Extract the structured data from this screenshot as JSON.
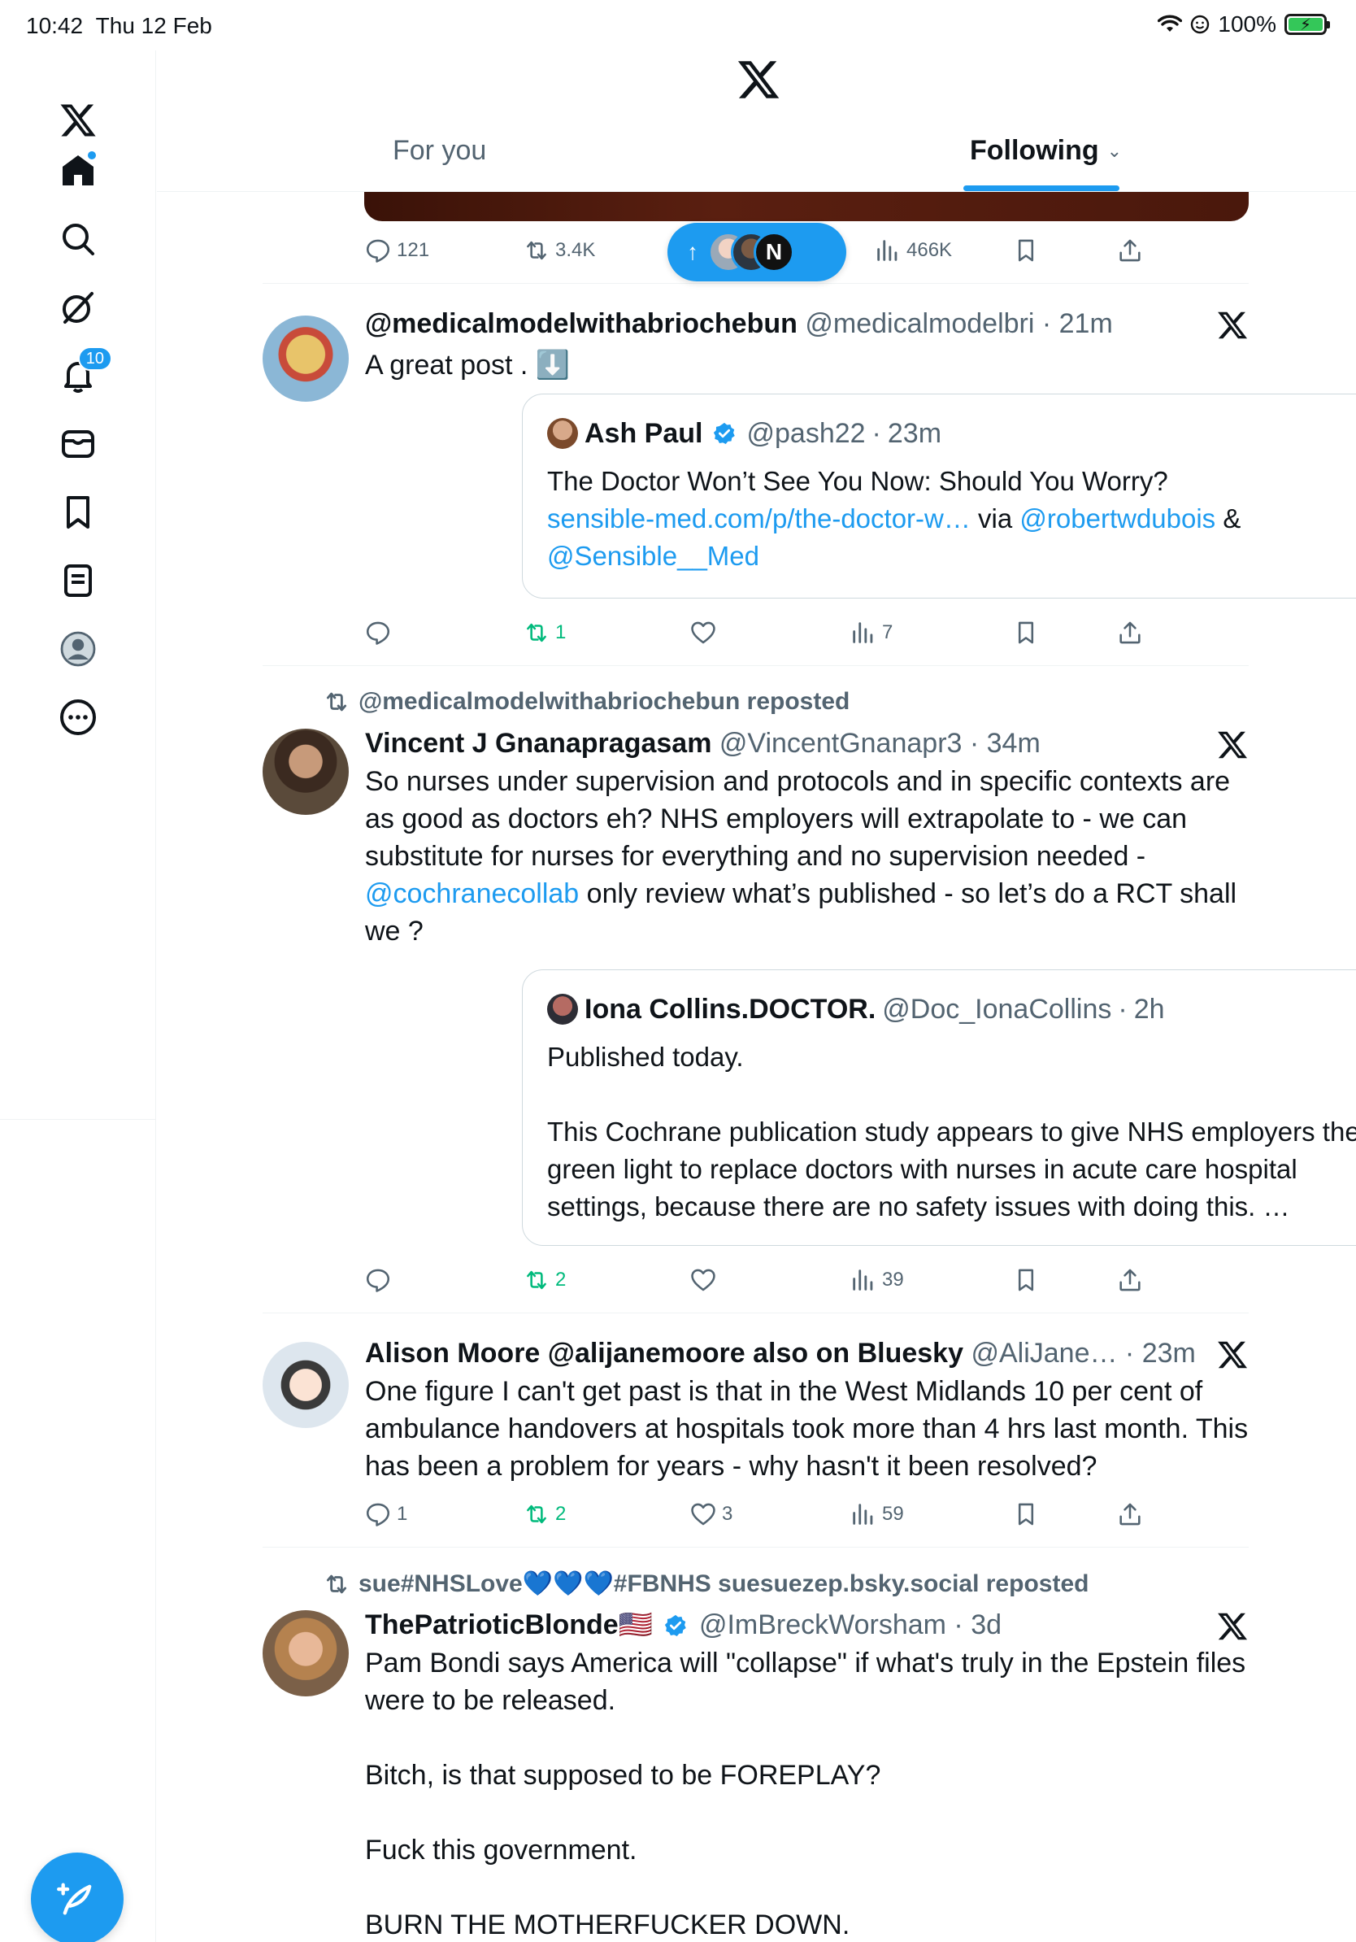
{
  "status_bar": {
    "time": "10:42",
    "date": "Thu 12 Feb",
    "battery": "100%"
  },
  "nav": {
    "notifications_count": "10"
  },
  "header": {
    "tabs": [
      {
        "label": "For you"
      },
      {
        "label": "Following"
      }
    ]
  },
  "colors": {
    "accent": "#1d9bf0",
    "repost_green": "#00ba7c",
    "muted": "#536471"
  },
  "posts": [
    {
      "actions": {
        "replies": "121",
        "reposts": "3.4K",
        "views": "466K"
      }
    },
    {
      "name": "@medicalmodelwithabriochebun",
      "handle": "@medicalmodelbri",
      "time": "21m",
      "text": "A great post .",
      "emoji": "⬇️",
      "quote": {
        "name": "Ash Paul",
        "handle": "@pash22",
        "time": "23m",
        "text": "The Doctor Won’t See You Now: Should You Worry?",
        "link": "sensible-med.com/p/the-doctor-w…",
        "via": "via",
        "mention1": "@robertwdubois",
        "amp": "&",
        "mention2": "@Sensible__Med"
      },
      "actions": {
        "reposts": "1",
        "views": "7"
      }
    },
    {
      "repost_label": "@medicalmodelwithabriochebun reposted",
      "name": "Vincent J Gnanapragasam",
      "handle": "@VincentGnanapr3",
      "time": "34m",
      "text_a": "So nurses under supervision and protocols and in specific contexts are as good as doctors eh? NHS employers will extrapolate to - we can substitute for nurses for everything and no supervision needed -",
      "mention": "@cochranecollab",
      "text_b": "only review what’s published - so let’s do a RCT shall we ?",
      "quote": {
        "name": "Iona Collins.DOCTOR.",
        "handle": "@Doc_IonaCollins",
        "time": "2h",
        "text_1": "Published today.",
        "text_2": "This Cochrane publication study appears to give NHS employers the green light to replace doctors with nurses in acute care hospital settings, because there are no safety issues with doing this. …"
      },
      "actions": {
        "reposts": "2",
        "views": "39"
      }
    },
    {
      "name": "Alison Moore @alijanemoore also on Bluesky",
      "handle": "@AliJane…",
      "time": "23m",
      "text": "One figure I can't get past is that in the West Midlands 10 per cent of ambulance handovers at hospitals took more than 4 hrs last month. This has been a problem for years - why hasn't it been resolved?",
      "actions": {
        "replies": "1",
        "reposts": "2",
        "likes": "3",
        "views": "59"
      }
    },
    {
      "repost_label": "sue#NHSLove💙💙💙#FBNHS suesuezep.bsky.social reposted",
      "name": "ThePatrioticBlonde🇺🇸",
      "handle": "@ImBreckWorsham",
      "time": "3d",
      "text_1": "Pam Bondi says America will \"collapse\" if what's truly in the Epstein files were to be released.",
      "text_2": "Bitch, is that supposed to be FOREPLAY?",
      "text_3": "Fuck this government.",
      "text_4": "BURN THE MOTHERFUCKER DOWN."
    }
  ]
}
